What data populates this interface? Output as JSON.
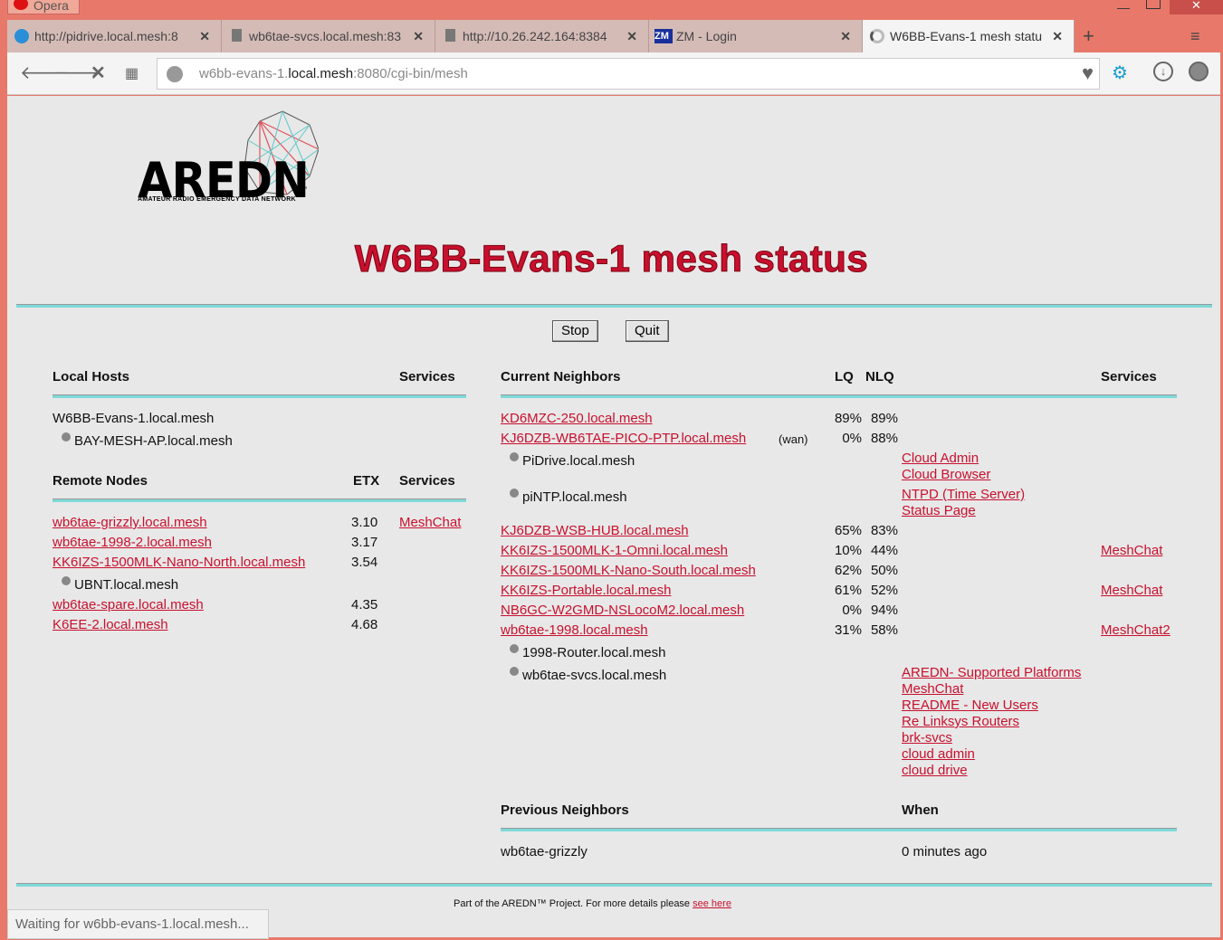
{
  "browser": {
    "app_name": "Opera",
    "tabs": [
      {
        "label": "http://pidrive.local.mesh:8",
        "icon": "globe-icon"
      },
      {
        "label": "wb6tae-svcs.local.mesh:83",
        "icon": "page-icon"
      },
      {
        "label": "http://10.26.242.164:8384",
        "icon": "page-icon"
      },
      {
        "label": "ZM - Login",
        "icon": "zm-icon",
        "icon_text": "ZM"
      },
      {
        "label": "W6BB-Evans-1 mesh statu",
        "icon": "loading-icon"
      }
    ],
    "url_pre": "w6bb-evans-1.",
    "url_host": "local.mesh",
    "url_post": ":8080/cgi-bin/mesh",
    "status": "Waiting for w6bb-evans-1.local.mesh..."
  },
  "logo": {
    "text": "AREDN",
    "tm": "™",
    "subtitle": "AMATEUR RADIO EMERGENCY DATA NETWORK"
  },
  "page_title": "W6BB-Evans-1 mesh status",
  "buttons": {
    "stop": "Stop",
    "quit": "Quit"
  },
  "local_hosts": {
    "header": "Local Hosts",
    "services_header": "Services",
    "host": "W6BB-Evans-1.local.mesh",
    "sub": [
      "BAY-MESH-AP.local.mesh"
    ]
  },
  "remote_nodes": {
    "header": "Remote Nodes",
    "etx_header": "ETX",
    "services_header": "Services",
    "rows": [
      {
        "name": "wb6tae-grizzly.local.mesh",
        "etx": "3.10",
        "service": "MeshChat"
      },
      {
        "name": "wb6tae-1998-2.local.mesh",
        "etx": "3.17"
      },
      {
        "name": "KK6IZS-1500MLK-Nano-North.local.mesh",
        "etx": "3.54",
        "sub": "UBNT.local.mesh"
      },
      {
        "name": "wb6tae-spare.local.mesh",
        "etx": "4.35"
      },
      {
        "name": "K6EE-2.local.mesh",
        "etx": "4.68"
      }
    ]
  },
  "neighbors": {
    "header": "Current Neighbors",
    "lq_header": "LQ",
    "nlq_header": "NLQ",
    "services_header": "Services",
    "rows": [
      {
        "name": "KD6MZC-250.local.mesh",
        "lq": "89%",
        "nlq": "89%"
      },
      {
        "name": "KJ6DZB-WB6TAE-PICO-PTP.local.mesh",
        "tag": "(wan)",
        "lq": "0%",
        "nlq": "88%"
      },
      {
        "name": "KJ6DZB-WSB-HUB.local.mesh",
        "lq": "65%",
        "nlq": "83%"
      },
      {
        "name": "KK6IZS-1500MLK-1-Omni.local.mesh",
        "lq": "10%",
        "nlq": "44%",
        "service": "MeshChat"
      },
      {
        "name": "KK6IZS-1500MLK-Nano-South.local.mesh",
        "lq": "62%",
        "nlq": "50%"
      },
      {
        "name": "KK6IZS-Portable.local.mesh",
        "lq": "61%",
        "nlq": "52%",
        "service": "MeshChat"
      },
      {
        "name": "NB6GC-W2GMD-NSLocoM2.local.mesh",
        "lq": "0%",
        "nlq": "94%"
      },
      {
        "name": "wb6tae-1998.local.mesh",
        "lq": "31%",
        "nlq": "58%",
        "service": "MeshChat2"
      }
    ],
    "hosts": [
      {
        "name": "PiDrive.local.mesh",
        "services": [
          "Cloud Admin",
          "Cloud Browser"
        ]
      },
      {
        "name": "piNTP.local.mesh",
        "services": [
          "NTPD (Time Server)",
          "Status Page"
        ]
      },
      {
        "name": "1998-Router.local.mesh"
      },
      {
        "name": "wb6tae-svcs.local.mesh",
        "services": [
          "AREDN- Supported Platforms",
          "MeshChat",
          "README - New Users",
          "Re Linksys Routers",
          "brk-svcs",
          "cloud admin",
          "cloud drive"
        ]
      }
    ]
  },
  "previous": {
    "header": "Previous Neighbors",
    "when_header": "When",
    "name": "wb6tae-grizzly",
    "when": "0 minutes ago"
  },
  "footer": {
    "text": "Part of the AREDN™ Project. For more details please",
    "link": "see here"
  }
}
